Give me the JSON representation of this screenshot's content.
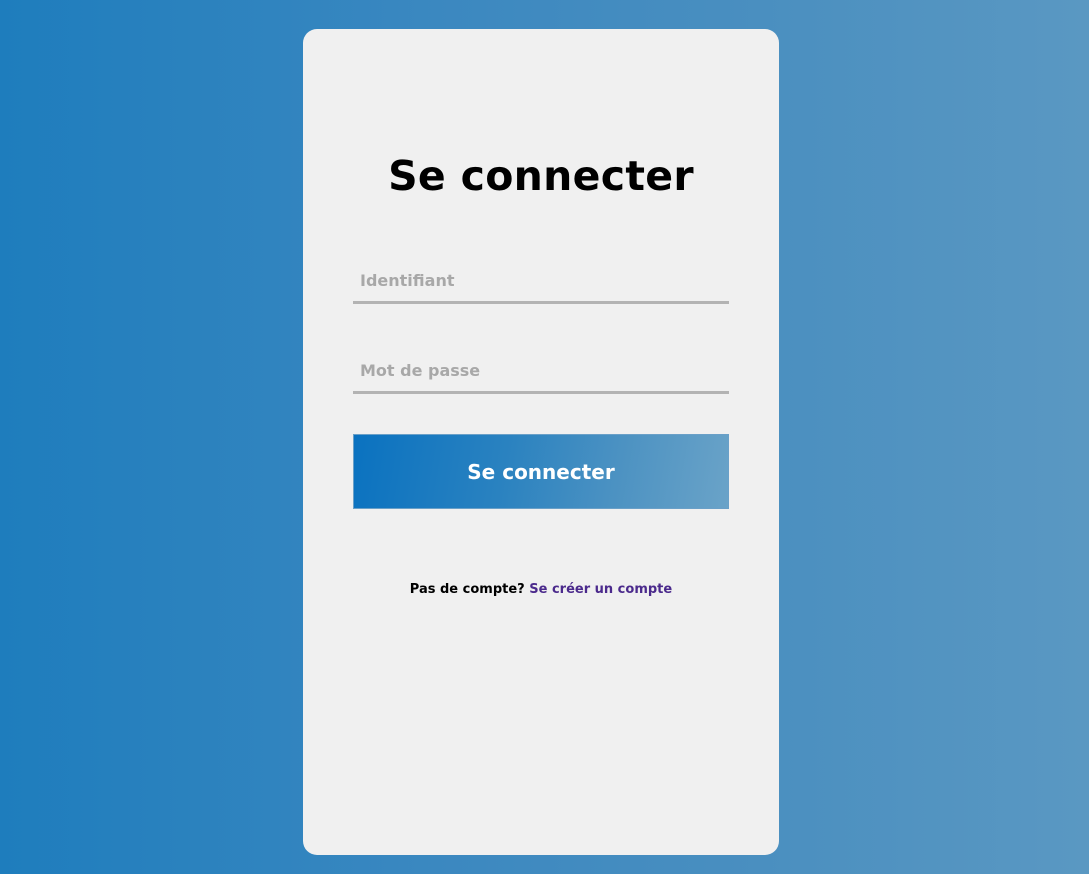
{
  "login": {
    "title": "Se connecter",
    "username": {
      "placeholder": "Identifiant",
      "value": ""
    },
    "password": {
      "placeholder": "Mot de passe",
      "value": ""
    },
    "submit_label": "Se connecter",
    "signup_prompt": "Pas de compte?",
    "signup_link": "Se créer un compte"
  },
  "colors": {
    "background_start": "#1e7dbd",
    "background_end": "#5a98c2",
    "card": "#f0f0f0",
    "button_start": "#0a72c0",
    "button_end": "#6aa3c8",
    "link": "#4b2a8c",
    "placeholder": "#a8a8a8",
    "underline": "#b3b3b3"
  }
}
